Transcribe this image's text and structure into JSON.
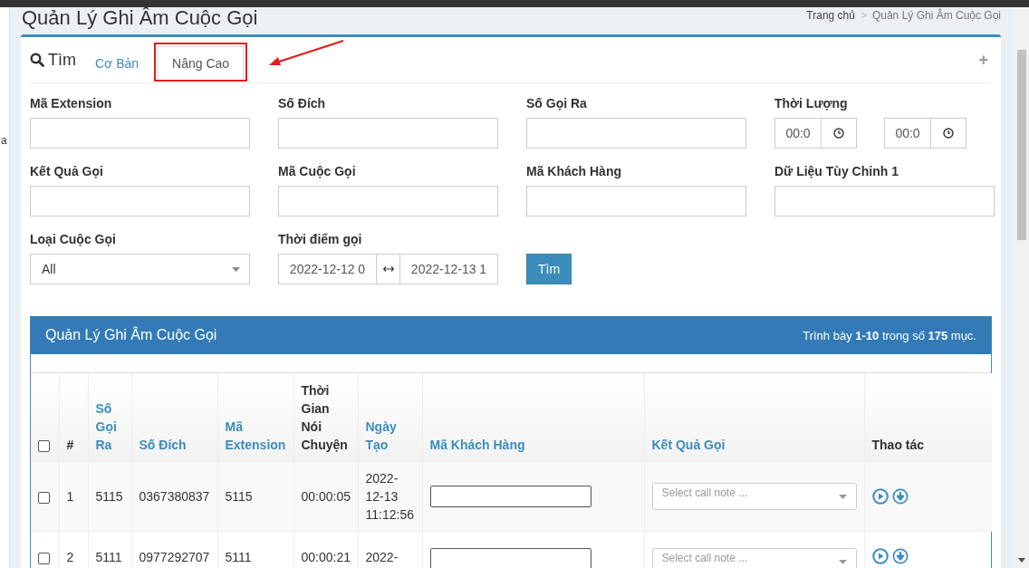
{
  "page": {
    "title": "Quản Lý Ghi Âm Cuộc Gọi",
    "breadcrumb": [
      "Trang chủ",
      "Quản Lý Ghi Âm Cuộc Gọi"
    ],
    "breadcrumb_separator": ">",
    "sidebar_text": "a"
  },
  "search": {
    "title": "Tìm",
    "expand_button": "+",
    "tabs": [
      {
        "label": "Cơ Bản",
        "selected": false,
        "highlighted": false
      },
      {
        "label": "Nâng Cao",
        "selected": true,
        "highlighted": true
      }
    ],
    "fields": [
      {
        "kind": "text",
        "label": "Mã Extension"
      },
      {
        "kind": "text",
        "label": "Số Đích"
      },
      {
        "kind": "text",
        "label": "Số Gọi Ra"
      },
      {
        "kind": "duration",
        "label": "Thời Lượng",
        "values": [
          "00:0",
          "00:0"
        ]
      },
      {
        "kind": "text",
        "label": "Kết Quả Gọi"
      },
      {
        "kind": "text",
        "label": "Mã Cuộc Gọi"
      },
      {
        "kind": "text",
        "label": "Mã Khách Hàng"
      },
      {
        "kind": "text",
        "label": "Dữ Liệu Tùy Chỉnh 1"
      },
      {
        "kind": "select",
        "label": "Loại Cuộc Gọi",
        "value": "All"
      },
      {
        "kind": "daterange",
        "label": "Thời điểm gọi",
        "from": "2022-12-12 0",
        "to": "2022-12-13 1"
      },
      {
        "kind": "button",
        "label": "Tìm"
      }
    ]
  },
  "table": {
    "title": "Quản Lý Ghi Âm Cuộc Gọi",
    "summary": "Trình bày **1-10** trong số **175** mục.",
    "select_all_checked": false,
    "columns": [
      {
        "label": "#",
        "sortable": false
      },
      {
        "label": "Số Gọi Ra",
        "sortable": true
      },
      {
        "label": "Số Đích",
        "sortable": true
      },
      {
        "label": "Mã Extension",
        "sortable": true
      },
      {
        "label": "Thời Gian Nói Chuyện",
        "sortable": false
      },
      {
        "label": "Ngày Tạo",
        "sortable": true
      },
      {
        "label": "Mã Khách Hàng",
        "sortable": true
      },
      {
        "label": "Kết Quả Gọi",
        "sortable": true
      },
      {
        "label": "Thao tác",
        "sortable": false
      }
    ],
    "rows": [
      {
        "checked": false,
        "cells": [
          "1",
          "5115",
          "0367380837",
          "5115",
          "00:00:05",
          "2022-12-13 11:12:56"
        ],
        "call_note_placeholder": "Select call note ..."
      },
      {
        "checked": false,
        "cells": [
          "2",
          "5111",
          "0977292707",
          "5111",
          "00:00:21",
          "2022-"
        ],
        "call_note_placeholder": "Select call note ..."
      }
    ]
  }
}
